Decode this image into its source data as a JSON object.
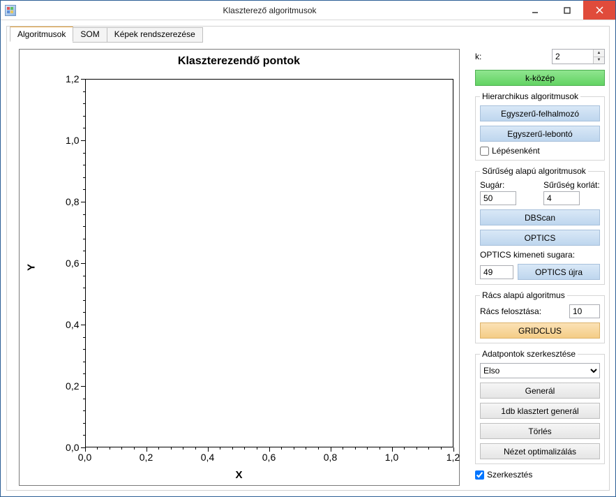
{
  "window": {
    "title": "Klaszterező algoritmusok"
  },
  "tabs": {
    "t0": "Algoritmusok",
    "t1": "SOM",
    "t2": "Képek rendszerezése"
  },
  "chart_data": {
    "type": "scatter",
    "title": "Klaszterezendő pontok",
    "xlabel": "X",
    "ylabel": "Y",
    "xlim": [
      0,
      1.2
    ],
    "ylim": [
      0,
      1.2
    ],
    "xticks": [
      "0,0",
      "0,2",
      "0,4",
      "0,6",
      "0,8",
      "1,0",
      "1,2"
    ],
    "yticks": [
      "0,0",
      "0,2",
      "0,4",
      "0,6",
      "0,8",
      "1,0",
      "1,2"
    ],
    "series": []
  },
  "k": {
    "label": "k:",
    "value": "2"
  },
  "kmeans_btn": "k-közép",
  "hier": {
    "legend": "Hierarchikus algoritmusok",
    "agglom_btn": "Egyszerű-felhalmozó",
    "divisive_btn": "Egyszerű-lebontó",
    "stepwise_label": "Lépésenként",
    "stepwise_checked": false
  },
  "density": {
    "legend": "Sűrűség alapú algoritmusok",
    "radius_label": "Sugár:",
    "radius_value": "50",
    "minpts_label": "Sűrűség korlát:",
    "minpts_value": "4",
    "dbscan_btn": "DBScan",
    "optics_btn": "OPTICS",
    "optics_out_label": "OPTICS kimeneti sugara:",
    "optics_out_value": "49",
    "optics_again_btn": "OPTICS újra"
  },
  "grid": {
    "legend": "Rács alapú algoritmus",
    "div_label": "Rács felosztása:",
    "div_value": "10",
    "gridclus_btn": "GRIDCLUS"
  },
  "edit": {
    "legend": "Adatpontok szerkesztése",
    "combo_value": "Elso",
    "generate_btn": "Generál",
    "gen1_btn": "1db klasztert generál",
    "clear_btn": "Törlés",
    "optimize_btn": "Nézet optimalizálás"
  },
  "editing": {
    "label": "Szerkesztés",
    "checked": true
  }
}
